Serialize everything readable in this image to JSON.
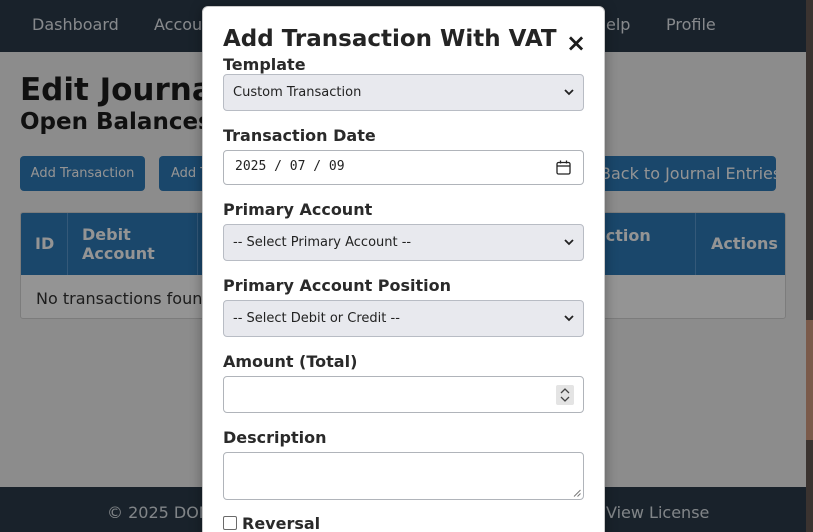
{
  "nav": {
    "items": [
      "Dashboard",
      "Accoun",
      "elp",
      "Profile"
    ]
  },
  "page": {
    "title": "Edit Journal",
    "subtitle": "Open Balances (",
    "buttons": {
      "add_transaction": "Add Transaction",
      "add_vat": "Add T",
      "back": "Back to Journal Entries"
    },
    "table": {
      "headers": {
        "id": "ID",
        "debit": "Debit Account",
        "transaction": "action",
        "actions": "Actions"
      },
      "empty_message": "No transactions found."
    }
  },
  "footer": {
    "copyright": "© 2025 DONI",
    "license": "View License"
  },
  "modal": {
    "title": "Add Transaction With VAT",
    "close_symbol": "×",
    "template": {
      "label": "Template",
      "value": "Custom Transaction"
    },
    "transaction_date": {
      "label": "Transaction Date",
      "value": "2025 / 07 / 09"
    },
    "primary_account": {
      "label": "Primary Account",
      "value": "-- Select Primary Account --"
    },
    "primary_account_position": {
      "label": "Primary Account Position",
      "value": "-- Select Debit or Credit --"
    },
    "amount": {
      "label": "Amount (Total)",
      "value": ""
    },
    "description": {
      "label": "Description",
      "value": ""
    },
    "reversal": {
      "label": "Reversal",
      "checked": false
    }
  },
  "icons": {
    "dropdown": "chevron-down-icon",
    "date": "calendar-icon",
    "spinner": "spinner-icon",
    "resize": "resize-grip-icon",
    "close": "close-icon"
  },
  "colors": {
    "navbar": "#2b3b4b",
    "primary_button": "#2e7ab8",
    "table_header": "#2e7ab8",
    "select_background": "#e8e9ee",
    "overlay": "rgba(0,0,0,0.42)"
  }
}
